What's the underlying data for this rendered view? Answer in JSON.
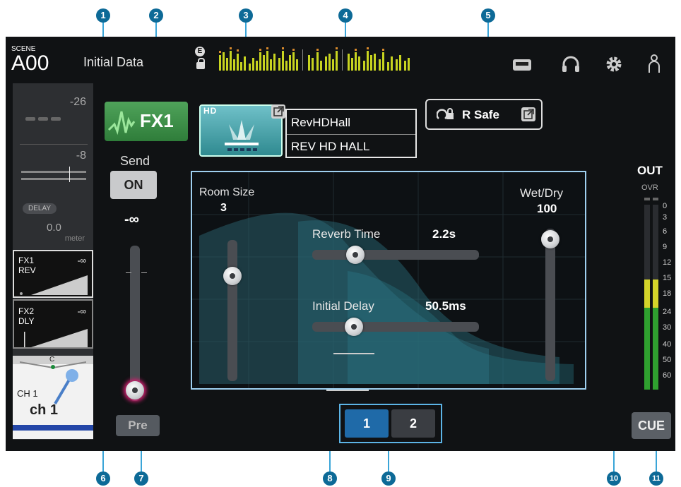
{
  "scene": {
    "label": "SCENE",
    "number": "A00",
    "name": "Initial Data"
  },
  "header": {
    "e_label": "E",
    "icons": [
      "cassette-icon",
      "headphones-icon",
      "gear-icon",
      "user-icon"
    ]
  },
  "channel_strip": {
    "value_top": "-26",
    "value_mid": "-8",
    "delay_label": "DELAY",
    "delay_value": "0.0",
    "delay_unit": "meter",
    "fx1": {
      "name": "FX1",
      "type": "REV",
      "level": "-∞"
    },
    "fx2": {
      "name": "FX2",
      "type": "DLY",
      "level": "-∞"
    },
    "pan_label": "C",
    "ch_label": "CH 1",
    "ch_name": "ch 1"
  },
  "fx_select_label": "FX1",
  "send": {
    "label": "Send",
    "on_label": "ON",
    "level": "-∞",
    "pre_label": "Pre",
    "fader_level": 0.0
  },
  "effect": {
    "hd_badge": "HD",
    "title": "RevHDHall",
    "type": "REV HD HALL",
    "rsafe_label": "R Safe"
  },
  "params": {
    "room_size": {
      "label": "Room Size",
      "value": "3",
      "level": 0.68
    },
    "wet_dry": {
      "label": "Wet/Dry",
      "value": "100",
      "level": 1.0
    },
    "reverb_time": {
      "label": "Reverb Time",
      "value": "2.2s",
      "level": 0.25
    },
    "initial_delay": {
      "label": "Initial Delay",
      "value": "50.5ms",
      "level": 0.24
    }
  },
  "pages": [
    "1",
    "2"
  ],
  "active_page": "1",
  "out_meter": {
    "label": "OUT",
    "ovr": "OVR",
    "scale": [
      "0",
      "3",
      "6",
      "9",
      "12",
      "15",
      "18",
      "24",
      "30",
      "40",
      "50",
      "60"
    ]
  },
  "cue_label": "CUE",
  "callouts": [
    "1",
    "2",
    "3",
    "4",
    "5",
    "6",
    "7",
    "8",
    "9",
    "10",
    "11"
  ],
  "colors": {
    "accent": "#5cb4e6",
    "fx_green": "#3f9a4a",
    "callout": "#0d6a97",
    "meter_green": "#2fa02f",
    "meter_yellow": "#d4d42a"
  }
}
